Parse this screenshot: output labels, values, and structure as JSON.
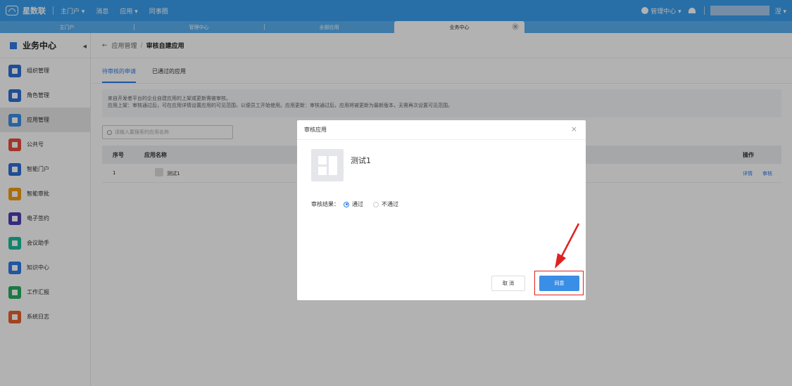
{
  "topbar": {
    "app_name": "星数联",
    "nav": [
      "主门户 ▾",
      "消息",
      "应用 ▾",
      "同事圈"
    ],
    "admin_center": "管理中心 ▾",
    "user_suffix": "涅 ▾"
  },
  "tabs": [
    {
      "label": "主门户",
      "active": false
    },
    {
      "label": "管理中心",
      "active": false
    },
    {
      "label": "全部应用",
      "active": false
    },
    {
      "label": "业务中心",
      "active": true
    }
  ],
  "sidebar": {
    "title": "业务中心",
    "items": [
      {
        "label": "组织管理",
        "icon": "org-icon",
        "color": "#2f6fd6"
      },
      {
        "label": "角色管理",
        "icon": "role-icon",
        "color": "#2f6fd6"
      },
      {
        "label": "应用管理",
        "icon": "app-grid-icon",
        "color": "#3a8ee6",
        "active": true
      },
      {
        "label": "公共号",
        "icon": "public-account-icon",
        "color": "#e84c3d"
      },
      {
        "label": "智能门户",
        "icon": "portal-icon",
        "color": "#2f6fd6"
      },
      {
        "label": "智能审批",
        "icon": "approval-icon",
        "color": "#f39c12"
      },
      {
        "label": "电子签约",
        "icon": "e-sign-icon",
        "color": "#4b3fb5"
      },
      {
        "label": "会议助手",
        "icon": "meeting-icon",
        "color": "#1abc9c"
      },
      {
        "label": "知识中心",
        "icon": "knowledge-icon",
        "color": "#2f7be8"
      },
      {
        "label": "工作汇报",
        "icon": "report-icon",
        "color": "#27ae60"
      },
      {
        "label": "系统日志",
        "icon": "log-icon",
        "color": "#e8602c"
      }
    ]
  },
  "breadcrumb": {
    "parent": "应用管理",
    "current": "审核自建应用"
  },
  "subtabs": {
    "pending": "待审核的申请",
    "approved": "已通过的应用"
  },
  "notice": {
    "line1": "来自开发者平台的企业自建应用的上架或更新需被审核。",
    "line2": "应用上架：审核通过后，可在应用详情设置应用的可见范围，以便员工开始使用。应用更新：审核通过后，应用将被更新为最新版本，无需再次设置可见范围。"
  },
  "search": {
    "placeholder": "请输入要搜索的应用名称"
  },
  "table": {
    "headers": {
      "index": "序号",
      "name": "应用名称",
      "actions": "操作"
    },
    "rows": [
      {
        "index": "1",
        "name": "测试1",
        "detail": "详情",
        "review": "审核"
      }
    ]
  },
  "dialog": {
    "title": "审核应用",
    "app_name": "测试1",
    "result_label": "审核结果：",
    "options": [
      {
        "label": "通过",
        "selected": true
      },
      {
        "label": "不通过",
        "selected": false
      }
    ],
    "cancel": "取 消",
    "confirm": "同意"
  },
  "colors": {
    "accent": "#2f7be8",
    "topbar": "#3aa0f0",
    "highlight": "#e02020"
  }
}
